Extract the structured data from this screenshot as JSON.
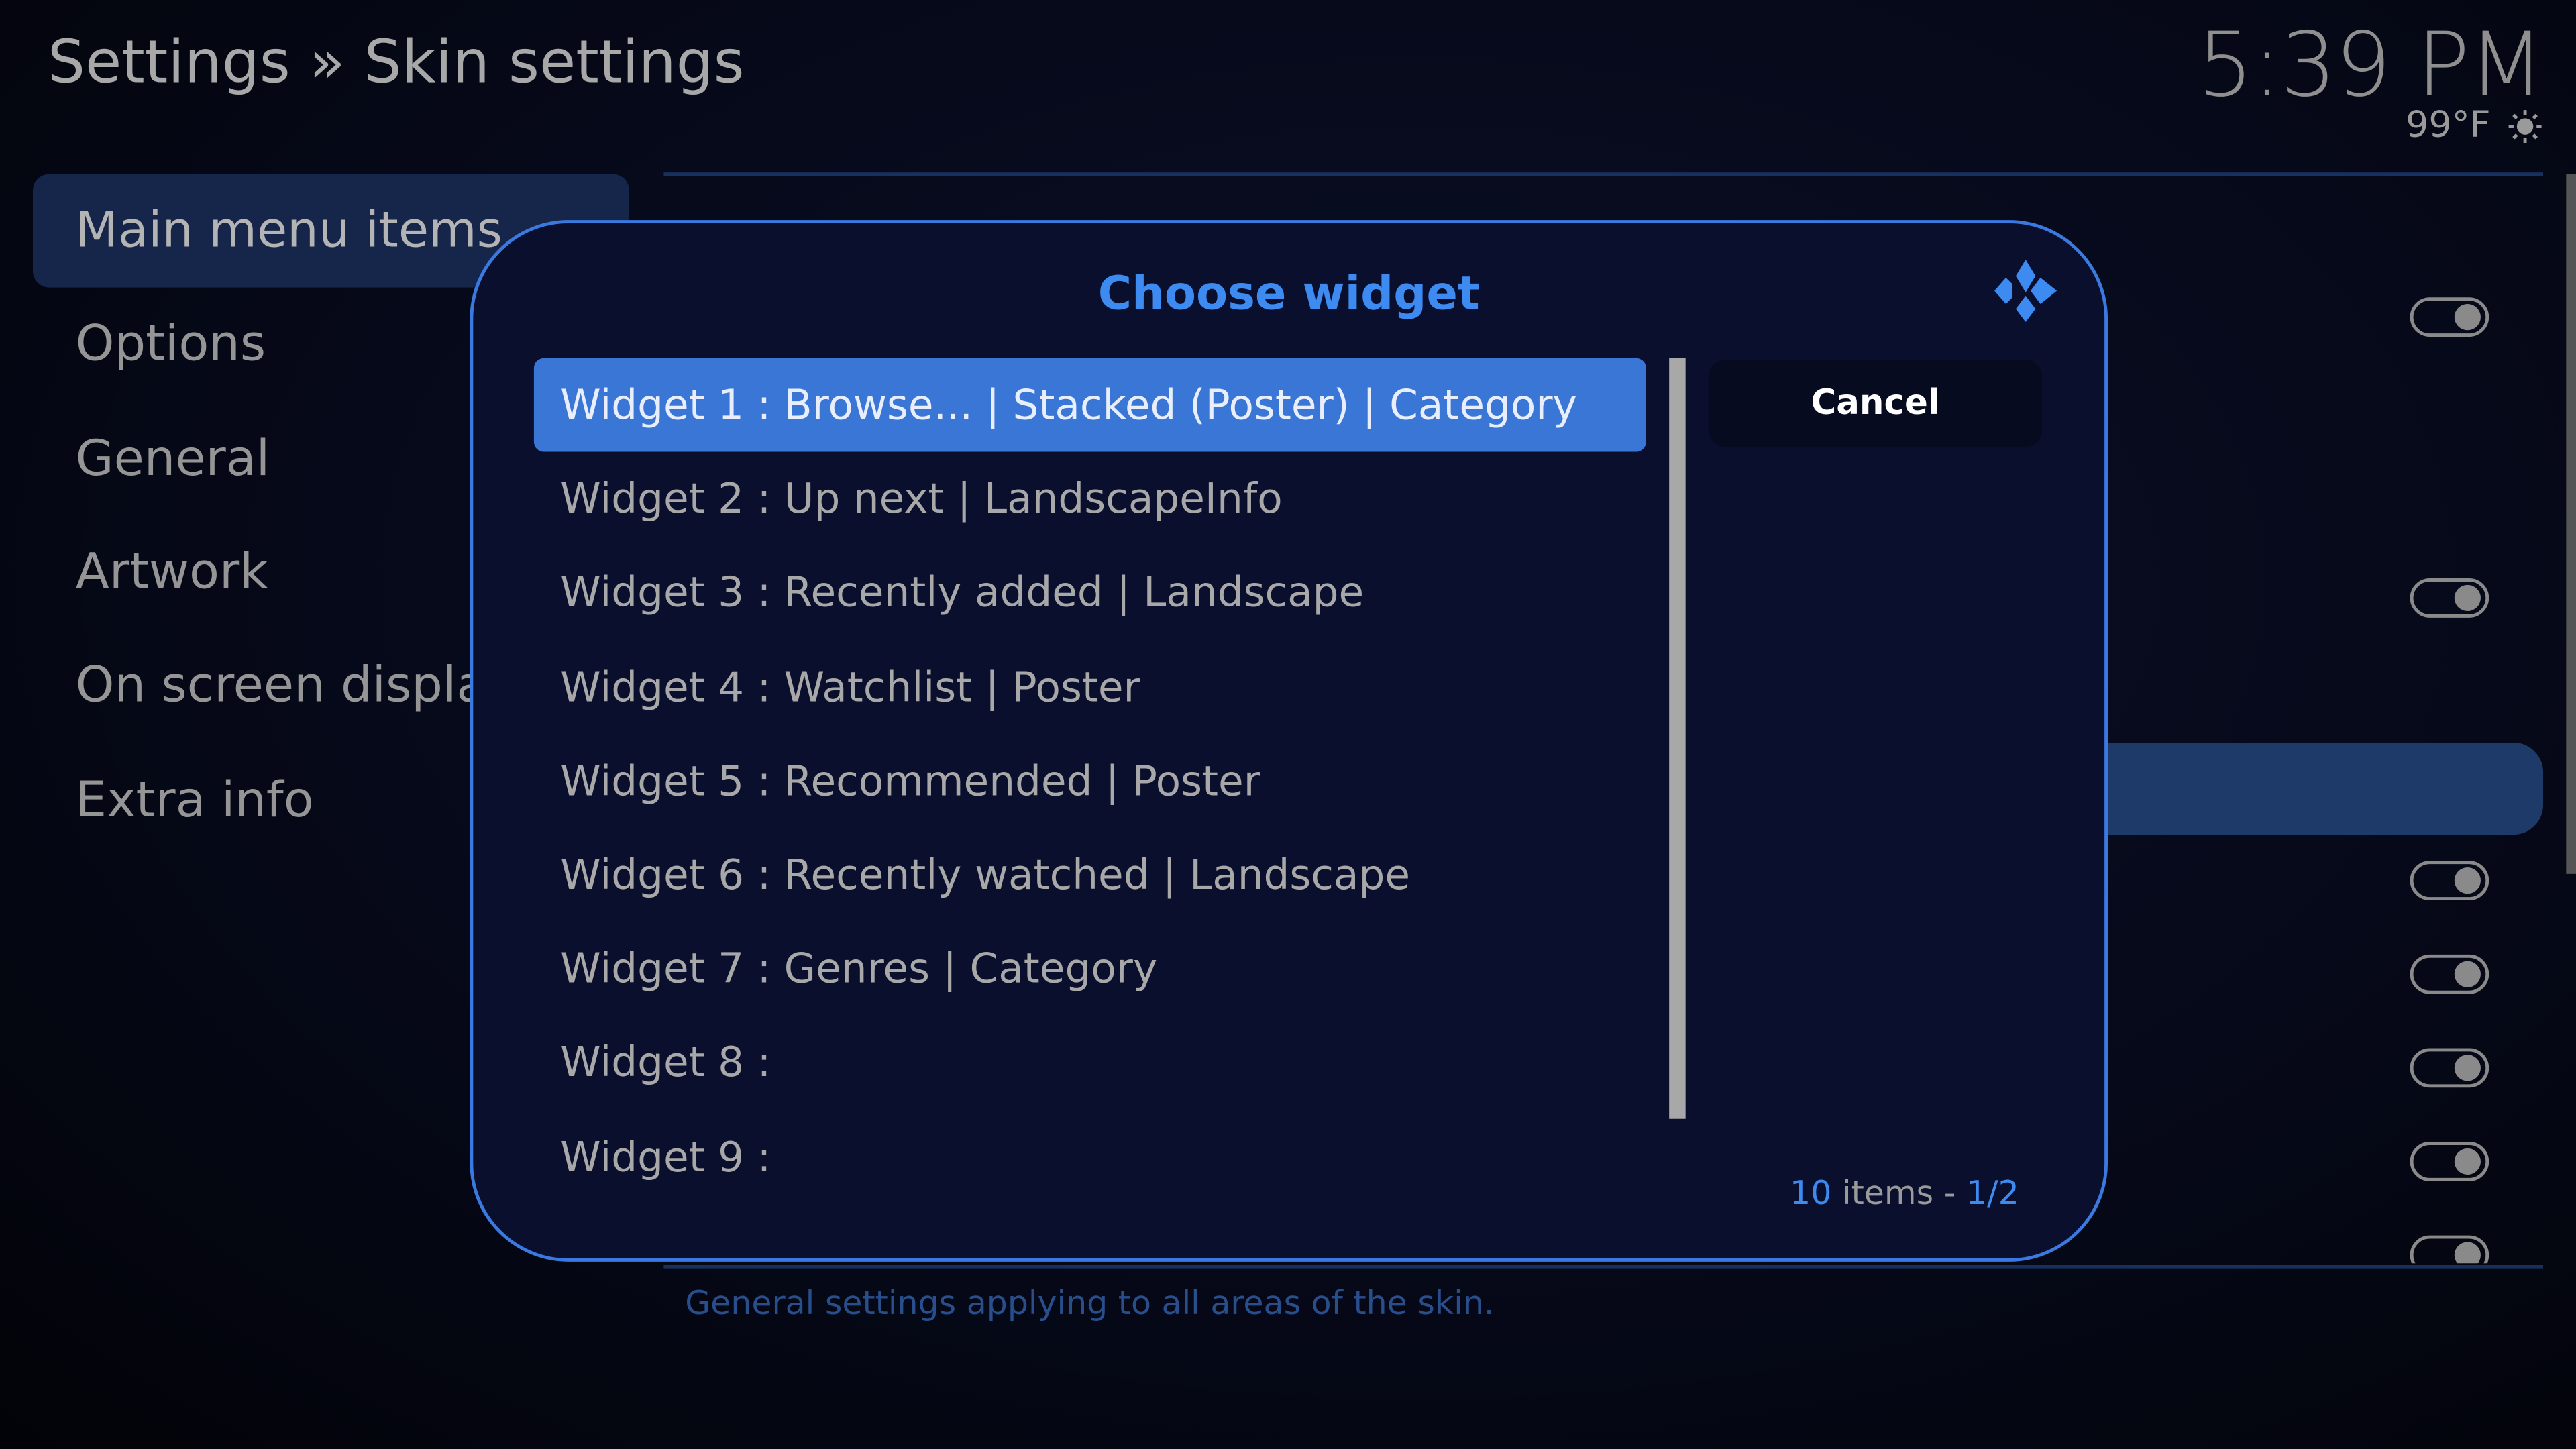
{
  "header": {
    "title": "Settings » Skin settings",
    "clock": "5:39 PM",
    "temperature": "99°F",
    "weather_icon": "sun-icon"
  },
  "sidebar": {
    "items": [
      {
        "label": "Main menu items",
        "selected": true
      },
      {
        "label": "Options"
      },
      {
        "label": "General"
      },
      {
        "label": "Artwork"
      },
      {
        "label": "On screen display"
      },
      {
        "label": "Extra info"
      }
    ]
  },
  "settings": {
    "toggles_on": [
      true,
      true,
      true,
      true,
      true,
      true,
      true
    ]
  },
  "footer": {
    "description": "General settings applying to all areas of the skin."
  },
  "dialog": {
    "title": "Choose widget",
    "logo": "kodi-logo",
    "items": [
      "Widget 1 : Browse... | Stacked (Poster) | Category",
      "Widget 2 : Up next | LandscapeInfo",
      "Widget 3 : Recently added | Landscape",
      "Widget 4 : Watchlist | Poster",
      "Widget 5 : Recommended | Poster",
      "Widget 6 : Recently watched | Landscape",
      "Widget 7 : Genres | Category",
      "Widget 8 :",
      "Widget 9 :"
    ],
    "selected_index": 0,
    "cancel_label": "Cancel",
    "count_number": "10",
    "count_text": "items -",
    "page": "1/2"
  },
  "colors": {
    "accent": "#3a76d6",
    "title": "#3d8af0",
    "dialog_bg": "#0b0f2e"
  }
}
